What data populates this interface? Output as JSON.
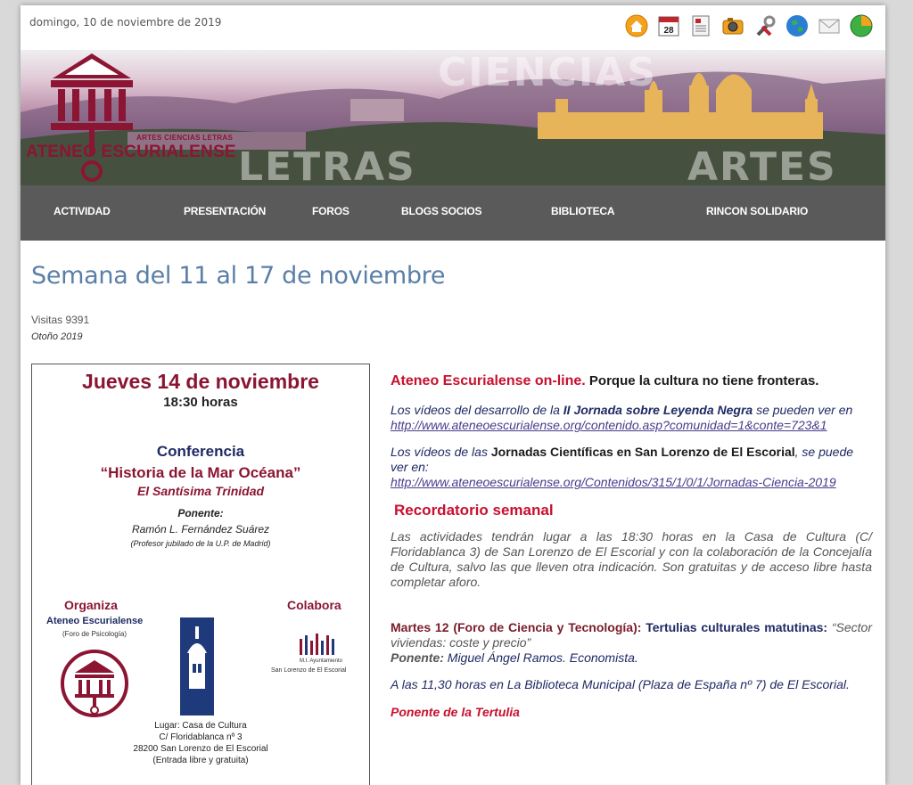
{
  "header": {
    "date": "domingo, 10 de noviembre de 2019",
    "icons": [
      "home-icon",
      "calendar-icon",
      "newspaper-icon",
      "camera-icon",
      "tools-icon",
      "globe-icon",
      "mail-icon",
      "world-icon"
    ],
    "calendar_day": "28"
  },
  "banner": {
    "logo_sub": "ARTES CIENCIAS LETRAS",
    "logo_title": "ATENEO ESCURIALENSE",
    "word_ciencias": "CIENCIAS",
    "word_letras": "LETRAS",
    "word_artes": "ARTES",
    "brand_color": "#8b1532"
  },
  "nav": {
    "items": [
      "ACTIVIDAD",
      "PRESENTACIÓN",
      "FOROS",
      "BLOGS SOCIOS",
      "BIBLIOTECA",
      "RINCON SOLIDARIO"
    ]
  },
  "main": {
    "title": "Semana del 11 al 17 de noviembre",
    "visits": "Visitas 9391",
    "season": "Otoño 2019"
  },
  "poster": {
    "day": "Jueves 14 de noviembre",
    "time": "18:30 horas",
    "type": "Conferencia",
    "talk_title": "“Historia de la Mar Océana”",
    "talk_sub": "El Santísima Trinidad",
    "speaker_label": "Ponente:",
    "speaker": "Ramón L. Fernández Suárez",
    "speaker_role": "(Profesor jubilado de la U.P. de Madrid)",
    "organiza_label": "Organiza",
    "organiza_name": "Ateneo Escurialense",
    "organiza_sub": "(Foro de Psicología)",
    "colabora_label": "Colabora",
    "colabora_name": "M.I. Ayuntamiento",
    "colabora_sub": "San Lorenzo de El Escorial",
    "venue_1": "Lugar: Casa de Cultura",
    "venue_2": "C/ Floridablanca nº 3",
    "venue_3": "28200 San Lorenzo de El Escorial",
    "venue_4": "(Entrada libre y gratuita)"
  },
  "content": {
    "online_red": "Ateneo Escurialense on-line.",
    "online_rest": " Porque la cultura no tiene  fronteras.",
    "videos1_pre": "Los vídeos del desarrollo de la ",
    "videos1_bold": "II Jornada sobre Leyenda Negra",
    "videos1_post": " se pueden ver en",
    "link1": "http://www.ateneoescurialense.org/contenido.asp?comunidad=1&conte=723&1",
    "videos2_pre": "Los vídeos de las ",
    "videos2_bold": "Jornadas Científicas en San Lorenzo de El Escorial",
    "videos2_post": ", se puede ver  en:",
    "link2": "http://www.ateneoescurialense.org/Contenidos/315/1/0/1/Jornadas-Ciencia-2019",
    "reminder_title": "Recordatorio semanal",
    "reminder_text": "Las actividades tendrán lugar a las 18:30 horas en la Casa de Cultura (C/ Floridablanca 3) de San Lorenzo de El Escorial y con la colaboración de la Concejalía de Cultura, salvo las que lleven otra indicación. Son gratuitas y de acceso libre hasta completar aforo.",
    "tue_label": "Martes 12 (Foro de Ciencia y Tecnología):",
    "tue_event": " Tertulias culturales matutinas: ",
    "tue_topic": "“Sector viviendas: coste y precio”",
    "tue_speaker_label": "Ponente:",
    "tue_speaker": " Miguel Ángel Ramos. Economista.",
    "tue_place": "A las 11,30 horas en La Biblioteca Municipal (Plaza de España nº 7) de El Escorial.",
    "cut_text": "Ponente de la Tertulia"
  }
}
